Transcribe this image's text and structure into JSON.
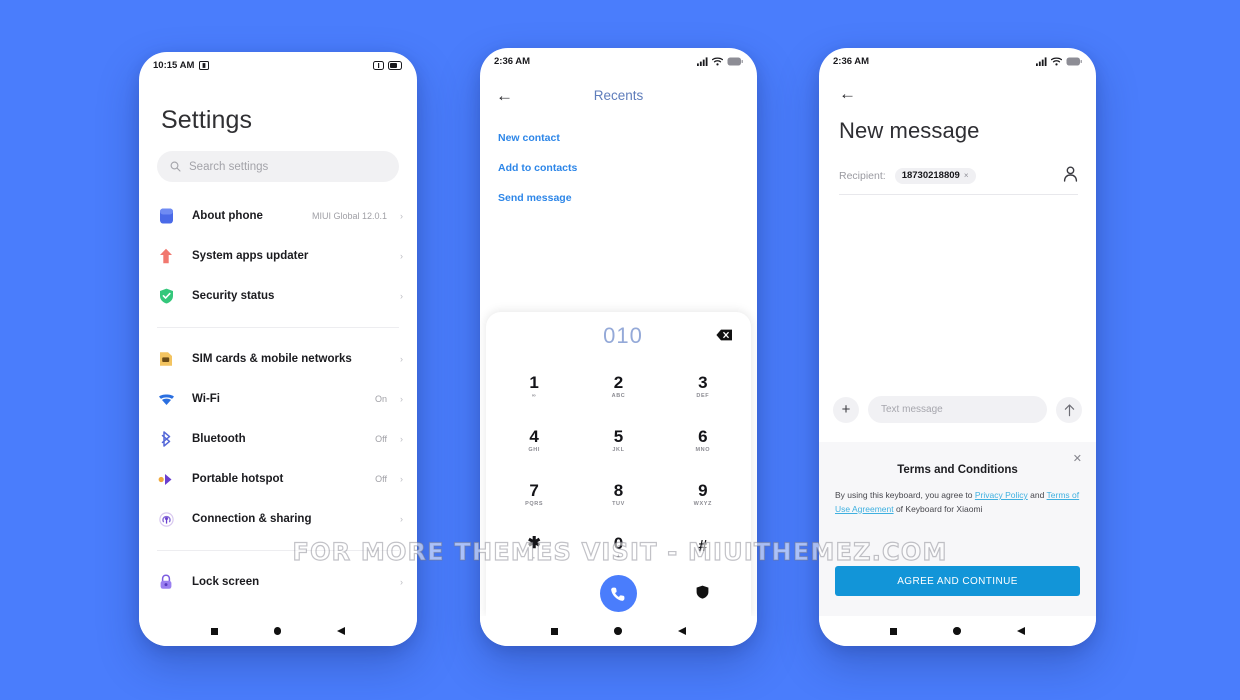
{
  "background_color": "#4a7dfc",
  "watermark": "FOR MORE THEMES VISIT - MIUITHEMEZ.COM",
  "settings_phone": {
    "status_bar": {
      "time": "10:15 AM",
      "left_icon": "screenshot-icon",
      "right_icons": [
        "vibrate-icon",
        "battery-icon"
      ]
    },
    "title": "Settings",
    "search": {
      "placeholder": "Search settings",
      "icon": "search-icon"
    },
    "items_group_1": [
      {
        "label": "About phone",
        "value": "MIUI Global 12.0.1",
        "icon": "phone-info-icon",
        "color": "#3b5bdb"
      },
      {
        "label": "System apps updater",
        "value": "",
        "icon": "up-arrow-icon",
        "color": "#f1786f"
      },
      {
        "label": "Security status",
        "value": "",
        "icon": "shield-check-icon",
        "color": "#34c77b"
      }
    ],
    "items_group_2": [
      {
        "label": "SIM cards & mobile networks",
        "value": "",
        "icon": "sim-card-icon",
        "color": "#f0b63c"
      },
      {
        "label": "Wi-Fi",
        "value": "On",
        "icon": "wifi-icon",
        "color": "#2a6fe0"
      },
      {
        "label": "Bluetooth",
        "value": "Off",
        "icon": "bluetooth-icon",
        "color": "#5568d8"
      },
      {
        "label": "Portable hotspot",
        "value": "Off",
        "icon": "hotspot-icon",
        "color": "#6a3fd0"
      },
      {
        "label": "Connection & sharing",
        "value": "",
        "icon": "connection-sharing-icon",
        "color": "#8a6fd8"
      }
    ],
    "items_group_3": [
      {
        "label": "Lock screen",
        "value": "",
        "icon": "lock-icon",
        "color": "#7c5ce0"
      }
    ],
    "chevron": "›"
  },
  "dialer_phone": {
    "status_bar": {
      "time": "2:36 AM",
      "right_icons": [
        "signal-icon",
        "wifi-icon",
        "battery-icon"
      ]
    },
    "back_icon": "back-arrow-icon",
    "title": "Recents",
    "actions": [
      "New contact",
      "Add to contacts",
      "Send message"
    ],
    "dialpad": {
      "number": "010",
      "delete_icon": "backspace-icon",
      "keys": [
        {
          "num": "1",
          "sub": "∞"
        },
        {
          "num": "2",
          "sub": "ABC"
        },
        {
          "num": "3",
          "sub": "DEF"
        },
        {
          "num": "4",
          "sub": "GHI"
        },
        {
          "num": "5",
          "sub": "JKL"
        },
        {
          "num": "6",
          "sub": "MNO"
        },
        {
          "num": "7",
          "sub": "PQRS"
        },
        {
          "num": "8",
          "sub": "TUV"
        },
        {
          "num": "9",
          "sub": "WXYZ"
        },
        {
          "num": "✱",
          "sub": ","
        },
        {
          "num": "0",
          "sub": "+"
        },
        {
          "num": "#",
          "sub": ""
        }
      ],
      "left_action_icon": "keypad-hide-icon",
      "call_icon": "call-icon",
      "right_action_icon": "shield-icon",
      "call_button_color": "#4a7dfc"
    }
  },
  "message_phone": {
    "status_bar": {
      "time": "2:36 AM",
      "right_icons": [
        "signal-icon",
        "wifi-icon",
        "battery-icon"
      ]
    },
    "back_icon": "back-arrow-icon",
    "title": "New message",
    "recipient": {
      "label": "Recipient:",
      "chip_value": "18730218809",
      "chip_remove": "×",
      "contacts_icon": "contact-picker-icon"
    },
    "compose": {
      "add_icon": "plus-icon",
      "placeholder": "Text message",
      "send_icon": "send-arrow-icon"
    },
    "terms": {
      "close_icon": "close-icon",
      "title": "Terms and Conditions",
      "text_1": "By using this keyboard, you agree to ",
      "link_1": "Privacy Policy",
      "text_2": " and ",
      "link_2": "Terms of Use Agreement",
      "text_3": " of Keyboard for Xiaomi",
      "button_label": "AGREE AND CONTINUE",
      "button_color": "#1295d8",
      "link_color": "#3fb0e0"
    }
  }
}
